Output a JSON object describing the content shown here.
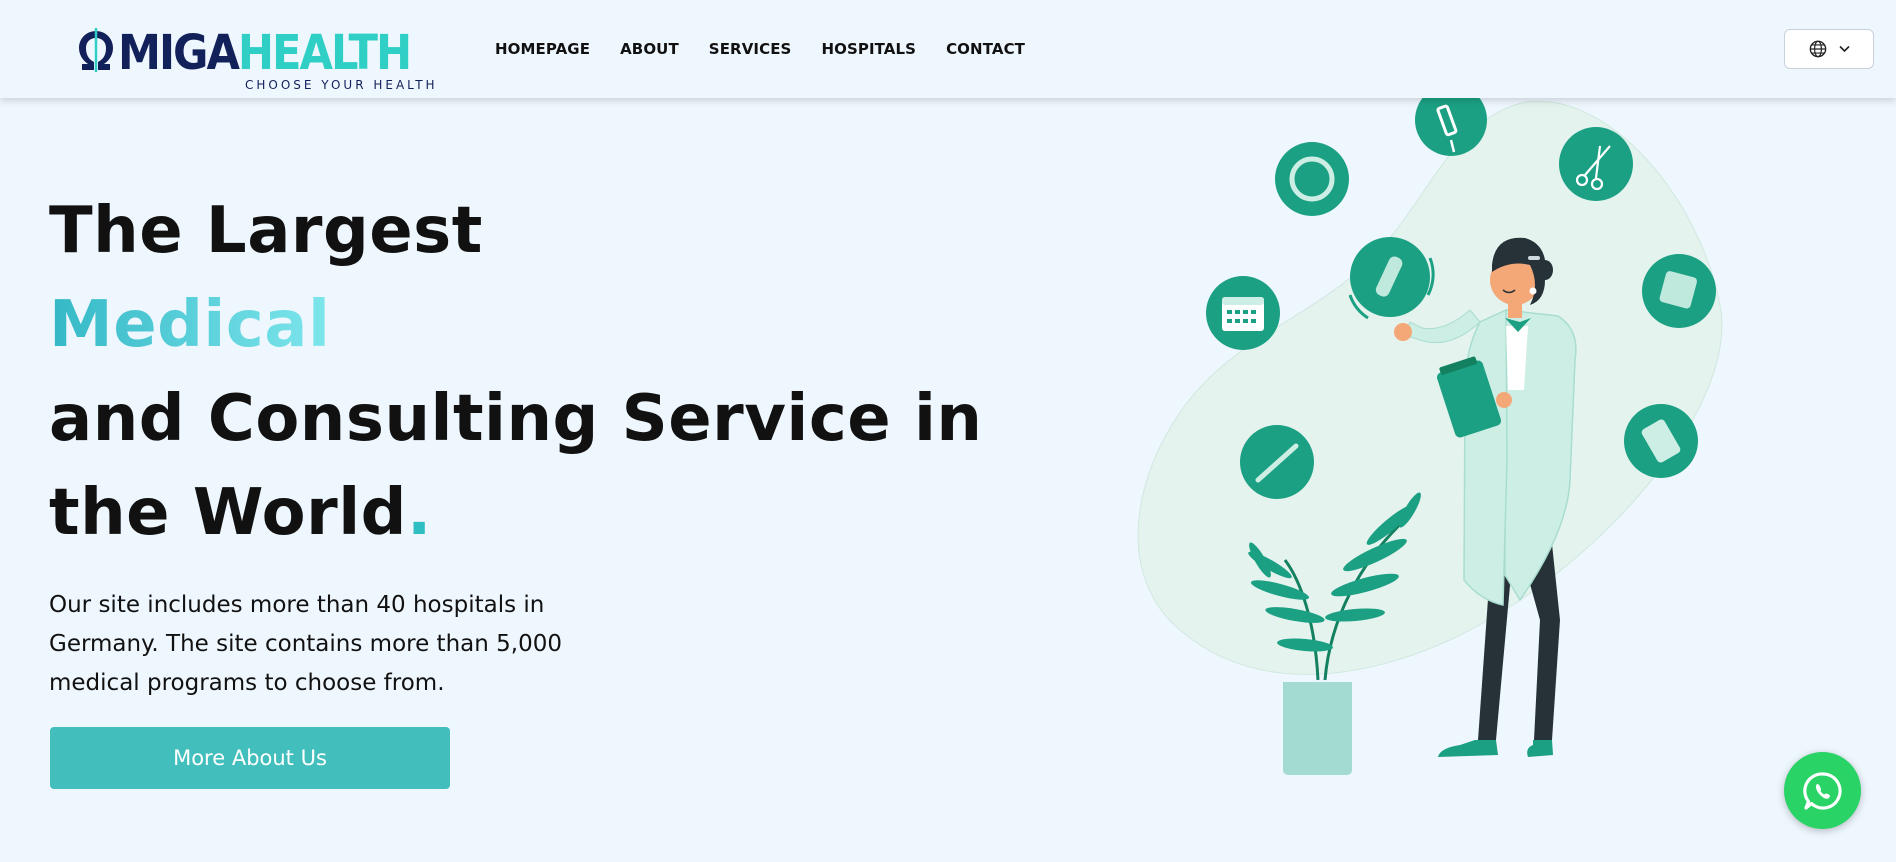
{
  "logo": {
    "word_part1": "MIGA",
    "word_part2": "HEALTH",
    "tagline": "CHOOSE YOUR HEALTH",
    "icon": "omega-logo-icon"
  },
  "nav": {
    "items": [
      {
        "label": "HOMEPAGE"
      },
      {
        "label": "ABOUT"
      },
      {
        "label": "SERVICES"
      },
      {
        "label": "HOSPITALS"
      },
      {
        "label": "CONTACT"
      }
    ]
  },
  "language": {
    "icon": "globe-icon",
    "caret": "chevron-down-icon"
  },
  "hero": {
    "title_line1": "The Largest",
    "title_accent": "Medical",
    "title_line3": "and Consulting Service in",
    "title_line4": "the World",
    "title_dot": ".",
    "description": "Our site includes more than 40 hospitals in Germany. The site contains more than 5,000 medical programs to choose from.",
    "cta_label": "More About Us"
  },
  "illustration": {
    "subject": "doctor-with-clipboard-illustration",
    "icons": [
      "calendar-icon",
      "test-tube-icon",
      "bandage-icon",
      "syringe-icon",
      "scissors-icon",
      "tablet-icon",
      "pills-icon",
      "thermometer-icon",
      "ring-icon"
    ]
  },
  "whatsapp": {
    "icon": "whatsapp-icon"
  },
  "colors": {
    "background": "#eff7fe",
    "brand_navy": "#13215a",
    "brand_teal": "#2fcfc6",
    "cta": "#42bfbc",
    "illustration_green": "#1ba083",
    "whatsapp": "#29d366"
  }
}
